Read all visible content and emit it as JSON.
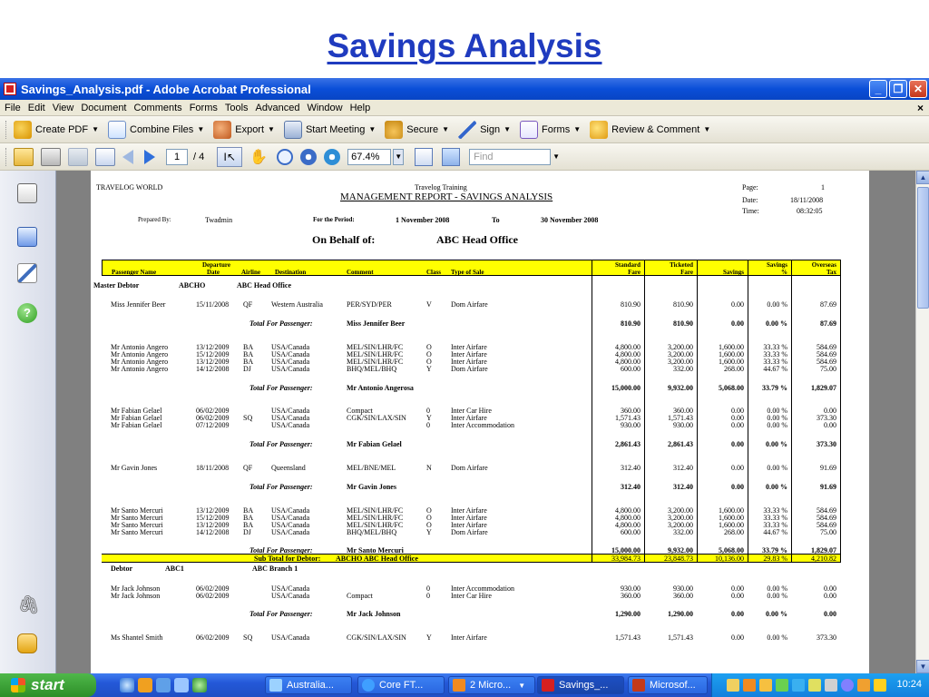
{
  "slide_title": "Savings Analysis",
  "window": {
    "title": "Savings_Analysis.pdf - Adobe Acrobat Professional",
    "menu": [
      "File",
      "Edit",
      "View",
      "Document",
      "Comments",
      "Forms",
      "Tools",
      "Advanced",
      "Window",
      "Help"
    ],
    "close_doc": "×"
  },
  "toolbar1": {
    "create_pdf": "Create PDF",
    "combine_files": "Combine Files",
    "export": "Export",
    "start_meeting": "Start Meeting",
    "secure": "Secure",
    "sign": "Sign",
    "forms": "Forms",
    "review_comment": "Review & Comment"
  },
  "toolbar2": {
    "page_current": "1",
    "page_total": "/ 4",
    "zoom": "67.4%",
    "find_placeholder": "Find"
  },
  "report": {
    "company": "TRAVELOG WORLD",
    "training": "Travelog Training",
    "title": "MANAGEMENT REPORT  - SAVINGS ANALYSIS",
    "page_label": "Page:",
    "page_value": "1",
    "date_label": "Date:",
    "date_value": "18/11/2008",
    "time_label": "Time:",
    "time_value": "08:32:05",
    "prepared_by_label": "Prepared By:",
    "prepared_by_value": "Twadmin",
    "period_label": "For the Period:",
    "period_from": "1 November 2008",
    "period_to_label": "To",
    "period_to": "30 November 2008",
    "behalf_label": "On Behalf of:",
    "behalf_value": "ABC Head Office",
    "columns": {
      "passenger_name": "Passenger Name",
      "departure": "Departure",
      "date": "Date",
      "airline": "Airline",
      "destination": "Destination",
      "comment": "Comment",
      "class": "Class",
      "type_of_sale": "Type of Sale",
      "standard": "Standard",
      "fare1": "Fare",
      "ticketed": "Ticketed",
      "fare2": "Fare",
      "savings": "Savings",
      "savings_pct_head": "Savings",
      "pct": "%",
      "overseas": "Overseas",
      "tax": "Tax"
    },
    "master_debtor_label": "Master Debtor",
    "master_debtor_code": "ABCHO",
    "master_debtor_name": "ABC Head Office",
    "total_for_passenger": "Total For Passenger:",
    "groups": [
      {
        "rows": [
          [
            "Miss Jennifer Beer",
            "15/11/2008",
            "QF",
            "Western Australia",
            "PER/SYD/PER",
            "V",
            "Dom Airfare",
            "810.90",
            "810.90",
            "0.00",
            "0.00 %",
            "87.69"
          ]
        ],
        "total": [
          "Miss Jennifer Beer",
          "810.90",
          "810.90",
          "0.00",
          "0.00 %",
          "87.69"
        ]
      },
      {
        "rows": [
          [
            "Mr Antonio Angero",
            "13/12/2009",
            "BA",
            "USA/Canada",
            "MEL/SIN/LHR/FC",
            "O",
            "Inter Airfare",
            "4,800.00",
            "3,200.00",
            "1,600.00",
            "33.33 %",
            "584.69"
          ],
          [
            "Mr Antonio Angero",
            "15/12/2009",
            "BA",
            "USA/Canada",
            "MEL/SIN/LHR/FC",
            "O",
            "Inter Airfare",
            "4,800.00",
            "3,200.00",
            "1,600.00",
            "33.33 %",
            "584.69"
          ],
          [
            "Mr Antonio Angero",
            "13/12/2009",
            "BA",
            "USA/Canada",
            "MEL/SIN/LHR/FC",
            "O",
            "Inter Airfare",
            "4,800.00",
            "3,200.00",
            "1,600.00",
            "33.33 %",
            "584.69"
          ],
          [
            "Mr Antonio Angero",
            "14/12/2008",
            "DJ",
            "USA/Canada",
            "BHQ/MEL/BHQ",
            "Y",
            "Dom Airfare",
            "600.00",
            "332.00",
            "268.00",
            "44.67 %",
            "75.00"
          ]
        ],
        "total": [
          "Mr Antonio Angerosa",
          "15,000.00",
          "9,932.00",
          "5,068.00",
          "33.79 %",
          "1,829.07"
        ]
      },
      {
        "rows": [
          [
            "Mr Fabian Gelael",
            "06/02/2009",
            "",
            "USA/Canada",
            "Compact",
            "0",
            "Inter Car Hire",
            "360.00",
            "360.00",
            "0.00",
            "0.00 %",
            "0.00"
          ],
          [
            "Mr Fabian Gelael",
            "06/02/2009",
            "SQ",
            "USA/Canada",
            "CGK/SIN/LAX/SIN",
            "Y",
            "Inter Airfare",
            "1,571.43",
            "1,571.43",
            "0.00",
            "0.00 %",
            "373.30"
          ],
          [
            "Mr Fabian Gelael",
            "07/12/2009",
            "",
            "USA/Canada",
            "",
            "0",
            "Inter Accommodation",
            "930.00",
            "930.00",
            "0.00",
            "0.00 %",
            "0.00"
          ]
        ],
        "total": [
          "Mr Fabian Gelael",
          "2,861.43",
          "2,861.43",
          "0.00",
          "0.00 %",
          "373.30"
        ]
      },
      {
        "rows": [
          [
            "Mr Gavin Jones",
            "18/11/2008",
            "QF",
            "Queensland",
            "MEL/BNE/MEL",
            "N",
            "Dom Airfare",
            "312.40",
            "312.40",
            "0.00",
            "0.00 %",
            "91.69"
          ]
        ],
        "total": [
          "Mr Gavin Jones",
          "312.40",
          "312.40",
          "0.00",
          "0.00 %",
          "91.69"
        ]
      },
      {
        "rows": [
          [
            "Mr Santo Mercuri",
            "13/12/2009",
            "BA",
            "USA/Canada",
            "MEL/SIN/LHR/FC",
            "O",
            "Inter Airfare",
            "4,800.00",
            "3,200.00",
            "1,600.00",
            "33.33 %",
            "584.69"
          ],
          [
            "Mr Santo Mercuri",
            "15/12/2009",
            "BA",
            "USA/Canada",
            "MEL/SIN/LHR/FC",
            "O",
            "Inter Airfare",
            "4,800.00",
            "3,200.00",
            "1,600.00",
            "33.33 %",
            "584.69"
          ],
          [
            "Mr Santo Mercuri",
            "13/12/2009",
            "BA",
            "USA/Canada",
            "MEL/SIN/LHR/FC",
            "O",
            "Inter Airfare",
            "4,800.00",
            "3,200.00",
            "1,600.00",
            "33.33 %",
            "584.69"
          ],
          [
            "Mr Santo Mercuri",
            "14/12/2008",
            "DJ",
            "USA/Canada",
            "BHQ/MEL/BHQ",
            "Y",
            "Dom Airfare",
            "600.00",
            "332.00",
            "268.00",
            "44.67 %",
            "75.00"
          ]
        ],
        "total": [
          "Mr Santo Mercuri",
          "15,000.00",
          "9,932.00",
          "5,068.00",
          "33.79 %",
          "1,829.07"
        ]
      }
    ],
    "subtotal": {
      "label": "Sub Total for Debtor:",
      "debtor": "ABCHO  ABC Head Office",
      "values": [
        "33,984.73",
        "23,848.73",
        "10,136.00",
        "29.83 %",
        "4,210.82"
      ]
    },
    "debtor2_label": "Debtor",
    "debtor2_code": "ABC1",
    "debtor2_name": "ABC Branch 1",
    "groups2": [
      {
        "rows": [
          [
            "Mr Jack Johnson",
            "06/02/2009",
            "",
            "USA/Canada",
            "",
            "0",
            "Inter Accommodation",
            "930.00",
            "930.00",
            "0.00",
            "0.00 %",
            "0.00"
          ],
          [
            "Mr Jack Johnson",
            "06/02/2009",
            "",
            "USA/Canada",
            "Compact",
            "0",
            "Inter Car Hire",
            "360.00",
            "360.00",
            "0.00",
            "0.00 %",
            "0.00"
          ]
        ],
        "total": [
          "Mr Jack Johnson",
          "1,290.00",
          "1,290.00",
          "0.00",
          "0.00 %",
          "0.00"
        ]
      }
    ],
    "last_row": [
      "Ms Shantel Smith",
      "06/02/2009",
      "SQ",
      "USA/Canada",
      "CGK/SIN/LAX/SIN",
      "Y",
      "Inter Airfare",
      "1,571.43",
      "1,571.43",
      "0.00",
      "0.00 %",
      "373.30"
    ]
  },
  "taskbar": {
    "start": "start",
    "tasks": [
      "Australia...",
      "Core FT...",
      "2 Micro...",
      "Savings_...",
      "Microsof..."
    ],
    "clock": "10:24"
  }
}
